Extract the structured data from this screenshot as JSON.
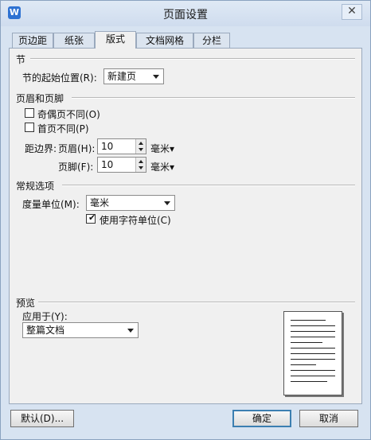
{
  "window": {
    "title": "页面设置",
    "app_icon": "W",
    "close": "✕"
  },
  "tabs": [
    {
      "label": "页边距",
      "active": false
    },
    {
      "label": "纸张",
      "active": false
    },
    {
      "label": "版式",
      "active": true
    },
    {
      "label": "文档网格",
      "active": false
    },
    {
      "label": "分栏",
      "active": false
    }
  ],
  "section": {
    "title": "节",
    "start_label": "节的起始位置(R):",
    "start_value": "新建页"
  },
  "header_footer": {
    "title": "页眉和页脚",
    "odd_even_label": "奇偶页不同(O)",
    "odd_even_checked": false,
    "first_page_label": "首页不同(P)",
    "first_page_checked": false,
    "margin_label": "距边界:",
    "header_label": "页眉(H):",
    "header_value": "10",
    "header_unit": "毫米▾",
    "footer_label": "页脚(F):",
    "footer_value": "10",
    "footer_unit": "毫米▾"
  },
  "general": {
    "title": "常规选项",
    "unit_label": "度量单位(M):",
    "unit_value": "毫米",
    "char_unit_label": "使用字符单位(C)",
    "char_unit_checked": true
  },
  "preview": {
    "title": "预览",
    "apply_label": "应用于(Y):",
    "apply_value": "整篇文档"
  },
  "buttons": {
    "default": "默认(D)...",
    "ok": "确定",
    "cancel": "取消"
  }
}
